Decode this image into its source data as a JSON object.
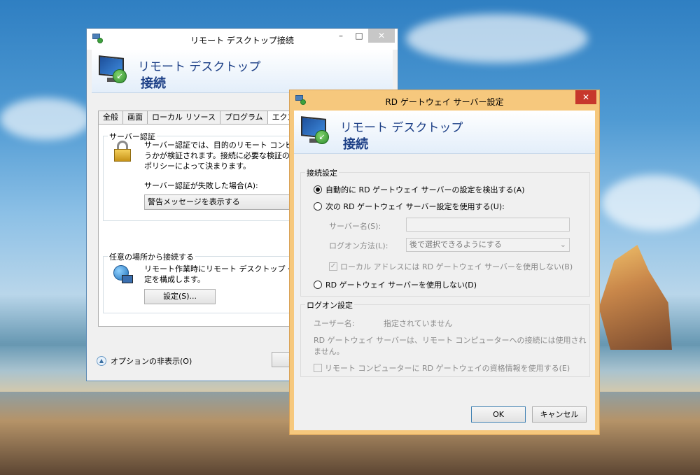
{
  "back_window": {
    "title": "リモート デスクトップ接続",
    "banner_line1": "リモート デスクトップ",
    "banner_line2": "接続",
    "tabs": [
      "全般",
      "画面",
      "ローカル リソース",
      "プログラム",
      "エクスペリエ"
    ],
    "server_auth": {
      "group_label": "サーバー認証",
      "description": [
        "サーバー認証では、目的のリモート コンピューター",
        "うかが検証されます。接続に必要な検証の度合い",
        "ポリシーによって決まります。"
      ],
      "fail_label": "サーバー認証が失敗した場合(A):",
      "fail_value": "警告メッセージを表示する"
    },
    "connect_anywhere": {
      "group_label": "任意の場所から接続する",
      "description": [
        "リモート作業時にリモート デスクトップ ゲートウェイ",
        "定を構成します。"
      ],
      "settings_button": "設定(S)..."
    },
    "options_toggle": "オプションの非表示(O)",
    "partial_button": "接"
  },
  "front_window": {
    "title": "RD ゲートウェイ サーバー設定",
    "banner_line1": "リモート デスクトップ",
    "banner_line2": "接続",
    "connection_settings": {
      "group_label": "接続設定",
      "radio_auto": "自動的に RD ゲートウェイ サーバーの設定を検出する(A)",
      "radio_manual": "次の RD ゲートウェイ サーバー設定を使用する(U):",
      "server_name_label": "サーバー名(S):",
      "server_name_value": "",
      "logon_method_label": "ログオン方法(L):",
      "logon_method_value": "後で選択できるようにする",
      "bypass_local": "ローカル アドレスには RD ゲートウェイ サーバーを使用しない(B)",
      "radio_none": "RD ゲートウェイ サーバーを使用しない(D)",
      "selected": "auto"
    },
    "logon_settings": {
      "group_label": "ログオン設定",
      "username_label": "ユーザー名:",
      "username_value": "指定されていません",
      "note": "RD ゲートウェイ サーバーは、リモート コンピューターへの接続には使用されません。",
      "use_credentials": "リモート コンピューターに RD ゲートウェイの資格情報を使用する(E)"
    },
    "ok_button": "OK",
    "cancel_button": "キャンセル"
  },
  "colors": {
    "accent_front_border": "#f6c87d",
    "banner_text": "#1c3f86",
    "close_red": "#c7372c"
  }
}
